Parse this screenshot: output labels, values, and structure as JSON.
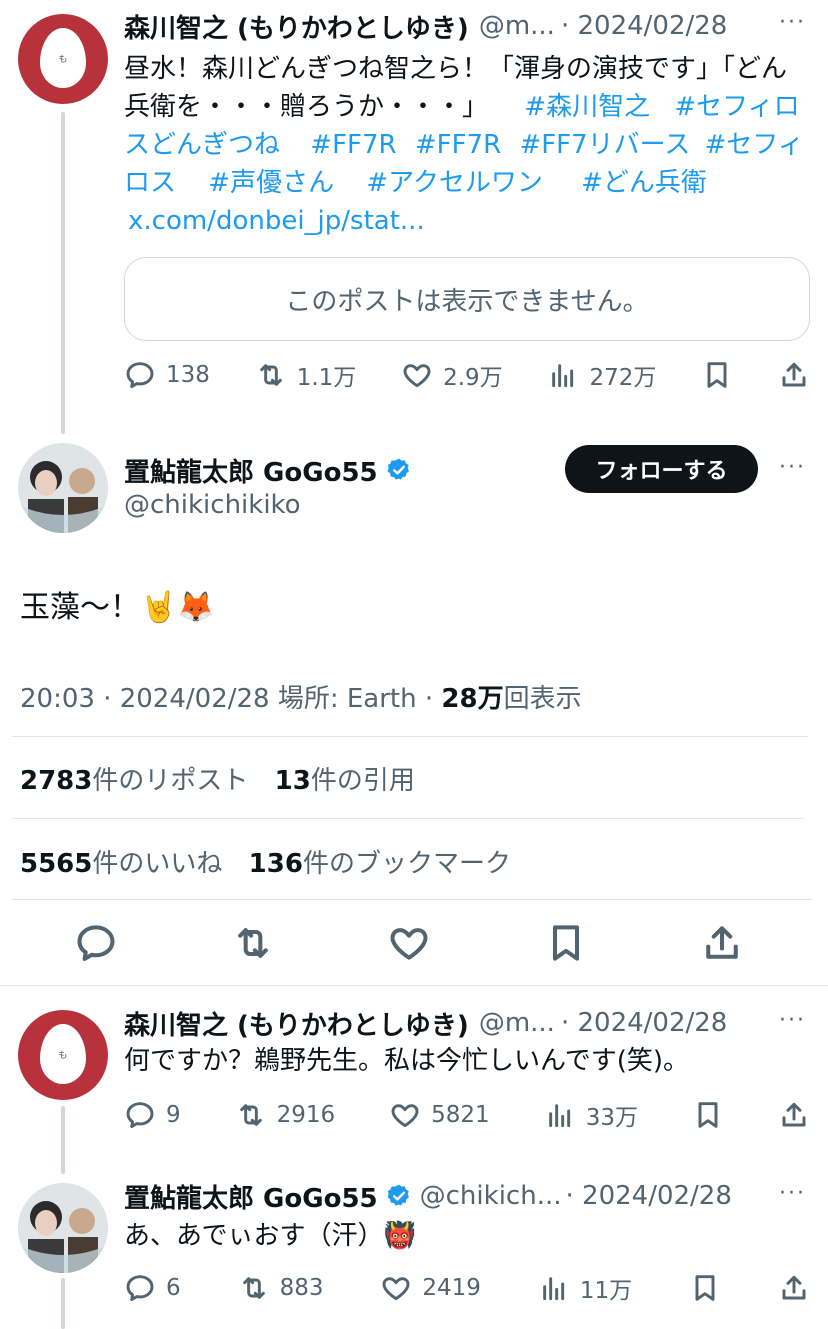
{
  "colors": {
    "accent": "#1d9bf0",
    "text": "#0f1419",
    "muted": "#536471",
    "egg_bg": "#b8323c"
  },
  "tweet1": {
    "name": "森川智之 (もりかわとしゆき)",
    "handle": "@m...",
    "date": "· 2024/02/28",
    "avatar_text": "も",
    "text_plain": "昼水！森川どんぎつね智之ら！「渾身の演技です」「どん兵衛を・・・贈ろうか・・・」",
    "hashtags": [
      "#森川智之",
      "#セフィロスどんぎつね",
      "#FF7R",
      "#FF7R",
      "#FF7リバース",
      "#セフィロス",
      "#声優さん",
      "#アクセルワン",
      "#どん兵衛"
    ],
    "link": "x.com/donbei_jp/stat...",
    "embed_notice": "このポストは表示できません。",
    "replies": "138",
    "reposts": "1.1万",
    "likes": "2.9万",
    "views": "272万"
  },
  "main": {
    "name": "置鮎龍太郎 GoGo55",
    "handle": "@chikichikiko",
    "follow_label": "フォローする",
    "text": "玉藻〜！🤘🦊",
    "time": "20:03 · 2024/02/28 場所: Earth · ",
    "views_count": "28万",
    "views_label": "回表示",
    "reposts_count": "2783",
    "reposts_label": "件のリポスト",
    "quotes_count": "13",
    "quotes_label": "件の引用",
    "likes_count": "5565",
    "likes_label": "件のいいね",
    "bookmarks_count": "136",
    "bookmarks_label": "件のブックマーク"
  },
  "reply1": {
    "name": "森川智之 (もりかわとしゆき)",
    "handle": "@m...",
    "date": "· 2024/02/28",
    "avatar_text": "も",
    "text": "何ですか？鵜野先生。私は今忙しいんです(笑)。",
    "replies": "9",
    "reposts": "2916",
    "likes": "5821",
    "views": "33万"
  },
  "reply2": {
    "name": "置鮎龍太郎 GoGo55",
    "handle": "@chikich...",
    "date": "· 2024/02/28",
    "text": "あ、あでぃおす（汗）👹",
    "replies": "6",
    "reposts": "883",
    "likes": "2419",
    "views": "11万"
  }
}
